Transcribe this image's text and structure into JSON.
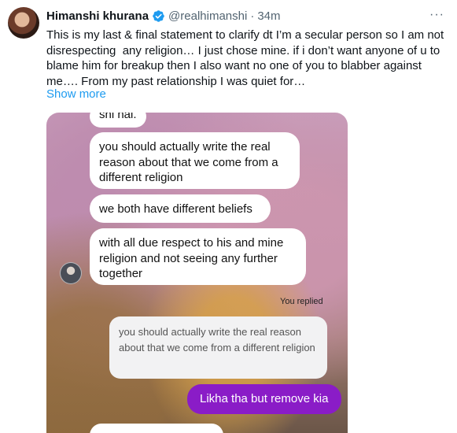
{
  "tweet": {
    "author_name": "Himanshi khurana",
    "handle": "@realhimanshi",
    "separator": "·",
    "time": "34m",
    "more_icon": "more-dots-icon",
    "verified_color": "#1d9bf0",
    "text": "This is my last & final statement to clarify dt I’m a secular person so I am not disrespecting  any religion… I just chose mine. if i don’t want anyone of u to blame him for breakup then I also want no one of you to blabber against me…. From my past relationship I was quiet for…",
    "show_more": "Show more"
  },
  "chat": {
    "messages_received": [
      {
        "text": "shi hai."
      },
      {
        "text": "you should actually write the real reason about that we come from a different religion"
      },
      {
        "text": "we both have different beliefs"
      },
      {
        "text": "with all due respect to his and mine religion and not seeing any further together"
      }
    ],
    "you_replied": "You replied",
    "quoted_text": "you should actually write the real reason about that we come from a different religion",
    "my_reply": "Likha tha but remove kia",
    "reply_bubble_color": "#8a1cc7"
  }
}
